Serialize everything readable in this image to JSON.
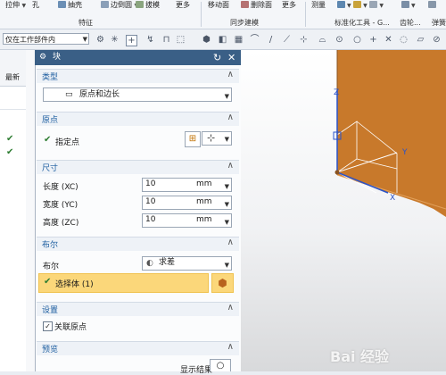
{
  "ribbon": {
    "tools": [
      {
        "label": "拉伸",
        "icon": "extrude-icon"
      },
      {
        "label": "孔",
        "icon": "hole-icon"
      },
      {
        "label": "抽壳",
        "icon": "shell-icon"
      },
      {
        "label": "边倒圆",
        "icon": "edge-blend-icon"
      },
      {
        "label": "拔模",
        "icon": "draft-icon"
      },
      {
        "label": "更多",
        "icon": "more-icon"
      },
      {
        "label": "移动面",
        "icon": "move-face-icon"
      },
      {
        "label": "删除面",
        "icon": "delete-face-icon"
      },
      {
        "label": "更多",
        "icon": "more-icon"
      },
      {
        "label": "测量",
        "icon": "measure-icon"
      }
    ],
    "groups": [
      "特征",
      "同步建模",
      "标准化工具 - G...",
      "齿轮...",
      "弹簧..."
    ]
  },
  "toolbar": {
    "selection_filter": "仅在工作部件内"
  },
  "navigator": {
    "update_label": "最新"
  },
  "dialog": {
    "title": "块",
    "type_section": {
      "title": "类型",
      "value": "原点和边长"
    },
    "origin_section": {
      "title": "原点",
      "specify_point": "指定点"
    },
    "dimensions_section": {
      "title": "尺寸",
      "rows": [
        {
          "label": "长度 (XC)",
          "value": "10",
          "unit": "mm"
        },
        {
          "label": "宽度 (YC)",
          "value": "10",
          "unit": "mm"
        },
        {
          "label": "高度 (ZC)",
          "value": "10",
          "unit": "mm"
        }
      ]
    },
    "boolean_section": {
      "title": "布尔",
      "label": "布尔",
      "value": "求差",
      "select_body": "选择体 (1)"
    },
    "settings_section": {
      "title": "设置",
      "associative_origin": "关联原点",
      "associative_origin_checked": true
    },
    "preview_section": {
      "title": "预览",
      "show_result": "显示结果"
    }
  },
  "viewport": {
    "axes": {
      "x": "X",
      "y": "Y",
      "z": "Z"
    },
    "colors": {
      "body": "#c8792b",
      "accent": "#1d5ea0",
      "title_bar": "#3a5f86"
    }
  },
  "watermark": "Bai 经验"
}
